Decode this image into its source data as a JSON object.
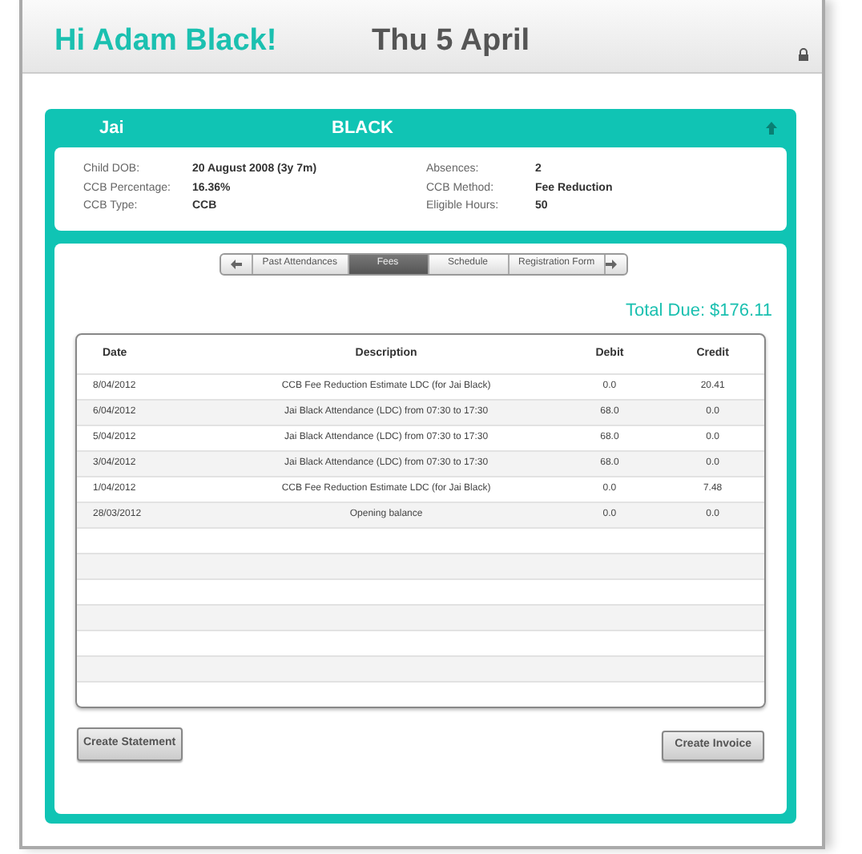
{
  "header": {
    "greeting": "Hi Adam Black!",
    "date": "Thu 5 April"
  },
  "child": {
    "first_name": "Jai",
    "last_name": "BLACK",
    "details": [
      {
        "label": "Child DOB:",
        "value": "20 August 2008 (3y 7m)"
      },
      {
        "label": "CCB Percentage:",
        "value": "16.36%"
      },
      {
        "label": "CCB Type:",
        "value": "CCB"
      },
      {
        "label": "Absences:",
        "value": "2"
      },
      {
        "label": "CCB Method:",
        "value": "Fee Reduction"
      },
      {
        "label": "Eligible Hours:",
        "value": "50"
      }
    ]
  },
  "tabs": [
    {
      "label": "Past Attendances",
      "selected": false
    },
    {
      "label": "Fees",
      "selected": true
    },
    {
      "label": "Schedule",
      "selected": false
    },
    {
      "label": "Registration Form",
      "selected": false
    }
  ],
  "total_due": "Total Due: $176.11",
  "table": {
    "columns": [
      "Date",
      "Description",
      "Debit",
      "Credit"
    ],
    "rows": [
      [
        "8/04/2012",
        "CCB Fee Reduction Estimate LDC (for Jai Black)",
        "0.0",
        "20.41"
      ],
      [
        "6/04/2012",
        "Jai Black Attendance (LDC) from 07:30 to 17:30",
        "68.0",
        "0.0"
      ],
      [
        "5/04/2012",
        "Jai Black Attendance (LDC) from 07:30 to 17:30",
        "68.0",
        "0.0"
      ],
      [
        "3/04/2012",
        "Jai Black Attendance (LDC) from 07:30 to 17:30",
        "68.0",
        "0.0"
      ],
      [
        "1/04/2012",
        "CCB Fee Reduction Estimate LDC (for Jai Black)",
        "0.0",
        "7.48"
      ],
      [
        "28/03/2012",
        "Opening balance",
        "0.0",
        "0.0"
      ]
    ]
  },
  "buttons": [
    "Create Statement",
    "Create Invoice"
  ]
}
